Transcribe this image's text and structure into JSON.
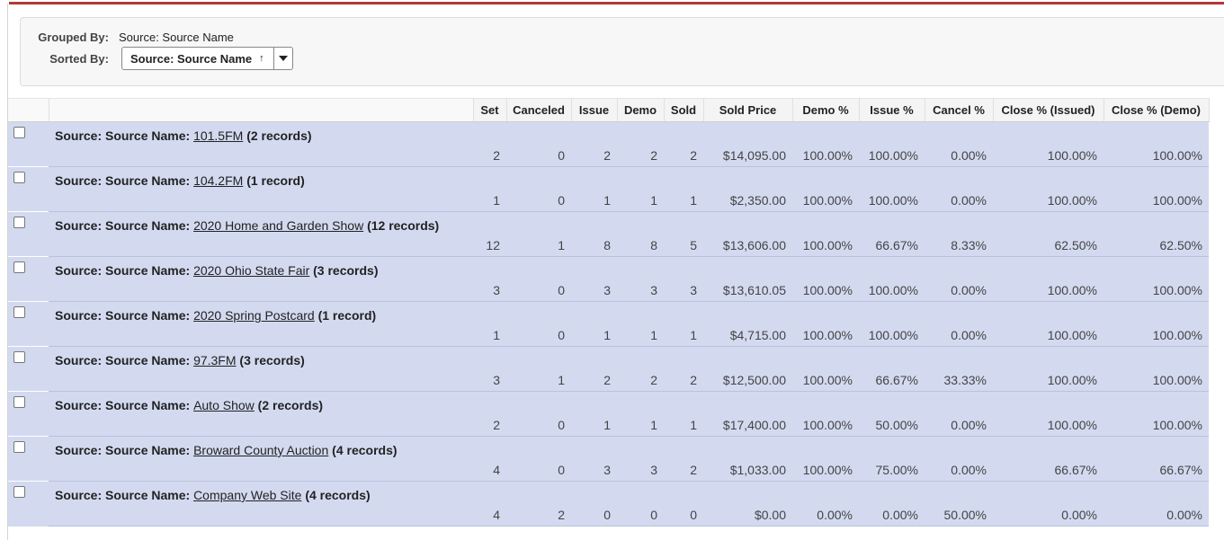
{
  "summary": {
    "grouped_by_label": "Grouped By:",
    "grouped_by_value": "Source: Source Name",
    "sorted_by_label": "Sorted By:",
    "sorted_by_value": "Source: Source Name",
    "sort_arrow": "↑"
  },
  "columns": [
    "Set",
    "Canceled",
    "Issue",
    "Demo",
    "Sold",
    "Sold Price",
    "Demo %",
    "Issue %",
    "Cancel %",
    "Close % (Issued)",
    "Close % (Demo)"
  ],
  "group_prefix": "Source: Source Name:",
  "groups": [
    {
      "name": "101.5FM",
      "count": "(2 records)",
      "values": [
        "2",
        "0",
        "2",
        "2",
        "2",
        "$14,095.00",
        "100.00%",
        "100.00%",
        "0.00%",
        "100.00%",
        "100.00%"
      ]
    },
    {
      "name": "104.2FM",
      "count": "(1 record)",
      "values": [
        "1",
        "0",
        "1",
        "1",
        "1",
        "$2,350.00",
        "100.00%",
        "100.00%",
        "0.00%",
        "100.00%",
        "100.00%"
      ]
    },
    {
      "name": "2020 Home and Garden Show",
      "count": "(12 records)",
      "values": [
        "12",
        "1",
        "8",
        "8",
        "5",
        "$13,606.00",
        "100.00%",
        "66.67%",
        "8.33%",
        "62.50%",
        "62.50%"
      ]
    },
    {
      "name": "2020 Ohio State Fair",
      "count": "(3 records)",
      "values": [
        "3",
        "0",
        "3",
        "3",
        "3",
        "$13,610.05",
        "100.00%",
        "100.00%",
        "0.00%",
        "100.00%",
        "100.00%"
      ]
    },
    {
      "name": "2020 Spring Postcard",
      "count": "(1 record)",
      "values": [
        "1",
        "0",
        "1",
        "1",
        "1",
        "$4,715.00",
        "100.00%",
        "100.00%",
        "0.00%",
        "100.00%",
        "100.00%"
      ]
    },
    {
      "name": "97.3FM",
      "count": "(3 records)",
      "values": [
        "3",
        "1",
        "2",
        "2",
        "2",
        "$12,500.00",
        "100.00%",
        "66.67%",
        "33.33%",
        "100.00%",
        "100.00%"
      ]
    },
    {
      "name": "Auto Show",
      "count": "(2 records)",
      "values": [
        "2",
        "0",
        "1",
        "1",
        "1",
        "$17,400.00",
        "100.00%",
        "50.00%",
        "0.00%",
        "100.00%",
        "100.00%"
      ]
    },
    {
      "name": "Broward County Auction",
      "count": "(4 records)",
      "values": [
        "4",
        "0",
        "3",
        "3",
        "2",
        "$1,033.00",
        "100.00%",
        "75.00%",
        "0.00%",
        "66.67%",
        "66.67%"
      ]
    },
    {
      "name": "Company Web Site",
      "count": "(4 records)",
      "values": [
        "4",
        "2",
        "0",
        "0",
        "0",
        "$0.00",
        "0.00%",
        "0.00%",
        "50.00%",
        "0.00%",
        "0.00%"
      ]
    }
  ]
}
